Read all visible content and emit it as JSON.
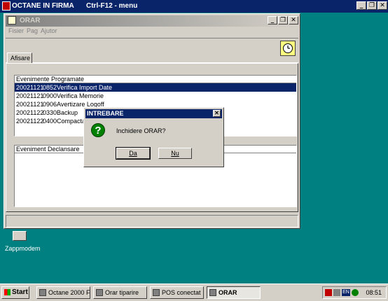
{
  "outer": {
    "title": "OCTANE IN FIRMA",
    "hint": "Ctrl-F12 - menu",
    "minimize": "_",
    "restore": "❐",
    "close": "✕"
  },
  "window": {
    "title": "ORAR",
    "menu": [
      "Fisier",
      "Pag",
      "Ajutor"
    ],
    "tab": "Afisare",
    "scheduled_label": "Evenimente Programate",
    "events": [
      {
        "date": "20021121",
        "time": "0852",
        "name": "Verifica Import Date",
        "selected": true
      },
      {
        "date": "20021121",
        "time": "0900",
        "name": "Verifica Memorie"
      },
      {
        "date": "20021121",
        "time": "0906",
        "name": "Avertizare Logoff"
      },
      {
        "date": "20021122",
        "time": "0330",
        "name": "Backup"
      },
      {
        "date": "20021122",
        "time": "0400",
        "name": "Compactare"
      }
    ],
    "trigger_label": "Eveniment Declansare"
  },
  "dialog": {
    "title": "INTREBARE",
    "message": "Inchidere ORAR?",
    "yes": "Da",
    "no": "Nu",
    "icon": "?"
  },
  "desktop": {
    "icon_label": "Zappmodem"
  },
  "taskbar": {
    "start": "Start",
    "tasks": [
      "Octane 2000 Fo...",
      "Orar tiparire",
      "POS conectat",
      "ORAR"
    ],
    "tray_lang": "EN",
    "clock": "08:51"
  }
}
